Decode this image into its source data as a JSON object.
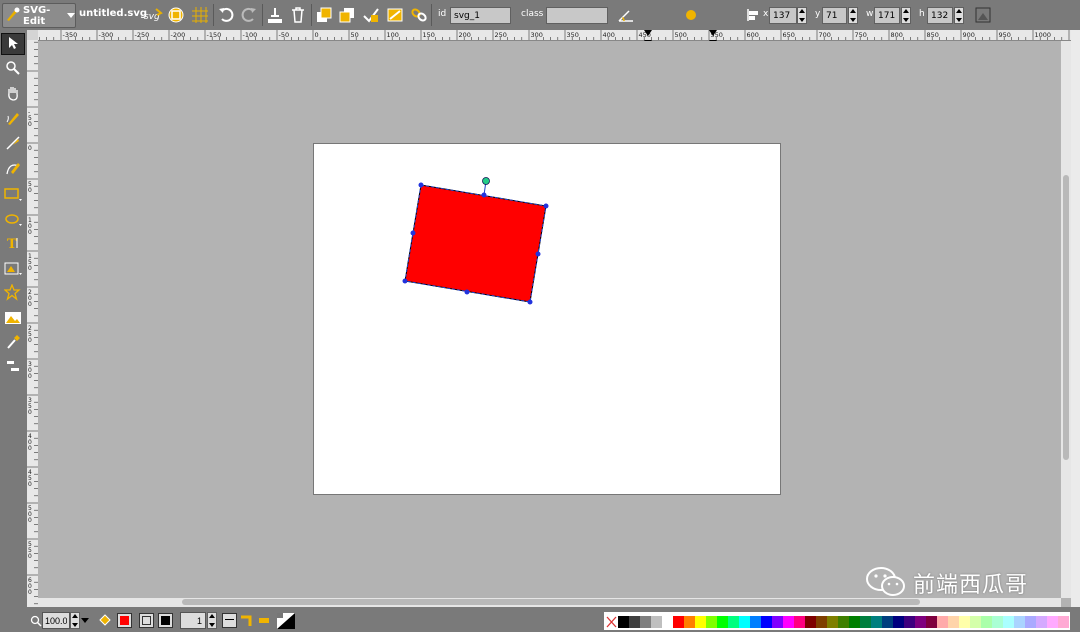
{
  "app": {
    "menu_label": "SVG-Edit",
    "document_title": "untitled.svg"
  },
  "toolbar": {
    "id_label": "id",
    "id_value": "svg_1",
    "class_label": "class",
    "class_value": "",
    "x_label": "x",
    "x_value": "137",
    "y_label": "y",
    "y_value": "71",
    "w_label": "w",
    "w_value": "171",
    "h_label": "h",
    "h_value": "132",
    "icons": [
      "svg-source-icon",
      "wireframe-icon",
      "grid-icon",
      "undo-icon",
      "redo-icon",
      "clone-icon",
      "delete-icon",
      "move-to-top-icon",
      "move-to-bottom-icon",
      "convert-to-path-icon",
      "reorient-icon",
      "link-icon",
      "angle-icon",
      "blur-icon",
      "align-icon",
      "tool-button-icon"
    ]
  },
  "rulers": {
    "horizontal_ticks": [
      "-350",
      "-300",
      "-250",
      "-200",
      "-150",
      "-100",
      "-50",
      "0",
      "50",
      "100",
      "150",
      "200",
      "250",
      "300",
      "350",
      "400",
      "450",
      "500",
      "550",
      "600",
      "650",
      "700",
      "750",
      "800",
      "850",
      "900",
      "950",
      "1000"
    ],
    "vertical_ticks": [
      "-50",
      "0",
      "50",
      "100",
      "150",
      "200",
      "250",
      "300",
      "350",
      "400",
      "450",
      "500",
      "550",
      "600",
      "650",
      "700"
    ]
  },
  "left_tools": [
    "select-icon",
    "zoom-icon",
    "pan-icon",
    "pencil-icon",
    "line-icon",
    "path-icon",
    "rect-icon",
    "ellipse-icon",
    "text-icon",
    "image-icon",
    "star-icon",
    "image-lib-icon",
    "eyedropper-icon",
    "layers-icon"
  ],
  "canvas": {
    "selected_shape": {
      "fill": "#ff0000",
      "stroke": "#000000"
    }
  },
  "bottombar": {
    "zoom_value": "100.0",
    "stroke_width_value": "1",
    "fill_color": "#ff0000",
    "stroke_color": "#000000"
  },
  "palette": [
    "#000000",
    "#3f3f3f",
    "#7f7f7f",
    "#bfbfbf",
    "#ffffff",
    "#ff0000",
    "#ff7f00",
    "#ffff00",
    "#7fff00",
    "#00ff00",
    "#00ff7f",
    "#00ffff",
    "#007fff",
    "#0000ff",
    "#7f00ff",
    "#ff00ff",
    "#ff007f",
    "#7f0000",
    "#7f3f00",
    "#7f7f00",
    "#3f7f00",
    "#007f00",
    "#007f3f",
    "#007f7f",
    "#003f7f",
    "#00007f",
    "#3f007f",
    "#7f007f",
    "#7f003f",
    "#ffaaaa",
    "#ffd4aa",
    "#ffffaa",
    "#d4ffaa",
    "#aaffaa",
    "#aaffd4",
    "#aaffff",
    "#aad4ff",
    "#aaaaff",
    "#d4aaff",
    "#ffaaff",
    "#ffaad4"
  ],
  "watermark": {
    "text": "前端西瓜哥"
  }
}
